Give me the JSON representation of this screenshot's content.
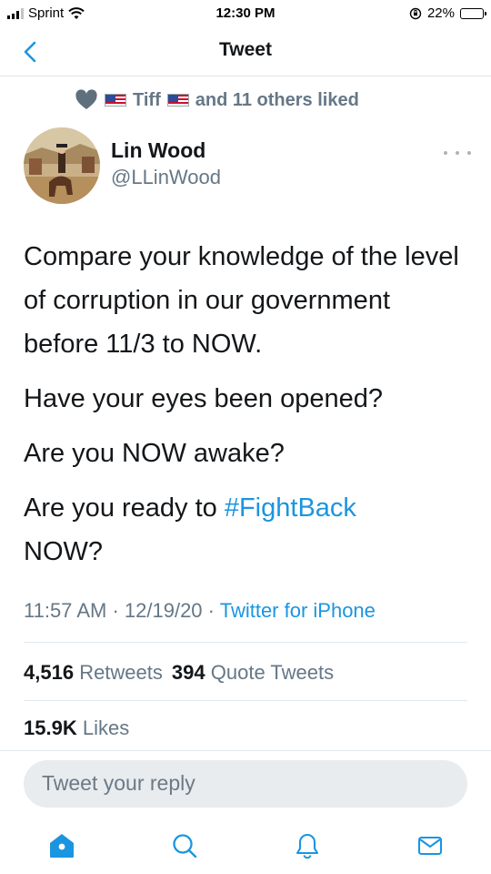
{
  "status_bar": {
    "carrier": "Sprint",
    "time": "12:30 PM",
    "battery": "22%",
    "battery_level": 0.22
  },
  "nav": {
    "title": "Tweet",
    "back_icon": "chevron-left-icon"
  },
  "liked_by": {
    "name": "Tiff",
    "others_text": "and 11 others liked"
  },
  "author": {
    "name": "Lin Wood",
    "handle": "@LLinWood"
  },
  "tweet": {
    "paragraph1": "Compare your knowledge of the level of corruption in our government before 11/3 to NOW.",
    "paragraph2": "Have your eyes been opened?",
    "paragraph3": "Are you NOW awake?",
    "paragraph4_prefix": "Are you ready to ",
    "hashtag": "#FightBack",
    "paragraph4_suffix": "NOW?"
  },
  "meta": {
    "time": "11:57 AM",
    "date": "12/19/20",
    "separator": "·",
    "source": "Twitter for iPhone"
  },
  "stats": {
    "retweets_count": "4,516",
    "retweets_label": "Retweets",
    "quotes_count": "394",
    "quotes_label": "Quote Tweets",
    "likes_count": "15.9K",
    "likes_label": "Likes"
  },
  "reply": {
    "placeholder": "Tweet your reply"
  },
  "tabs": [
    "home-icon",
    "search-icon",
    "notifications-icon",
    "messages-icon"
  ],
  "colors": {
    "accent": "#1b95e0",
    "muted": "#657786",
    "text": "#14171a"
  }
}
